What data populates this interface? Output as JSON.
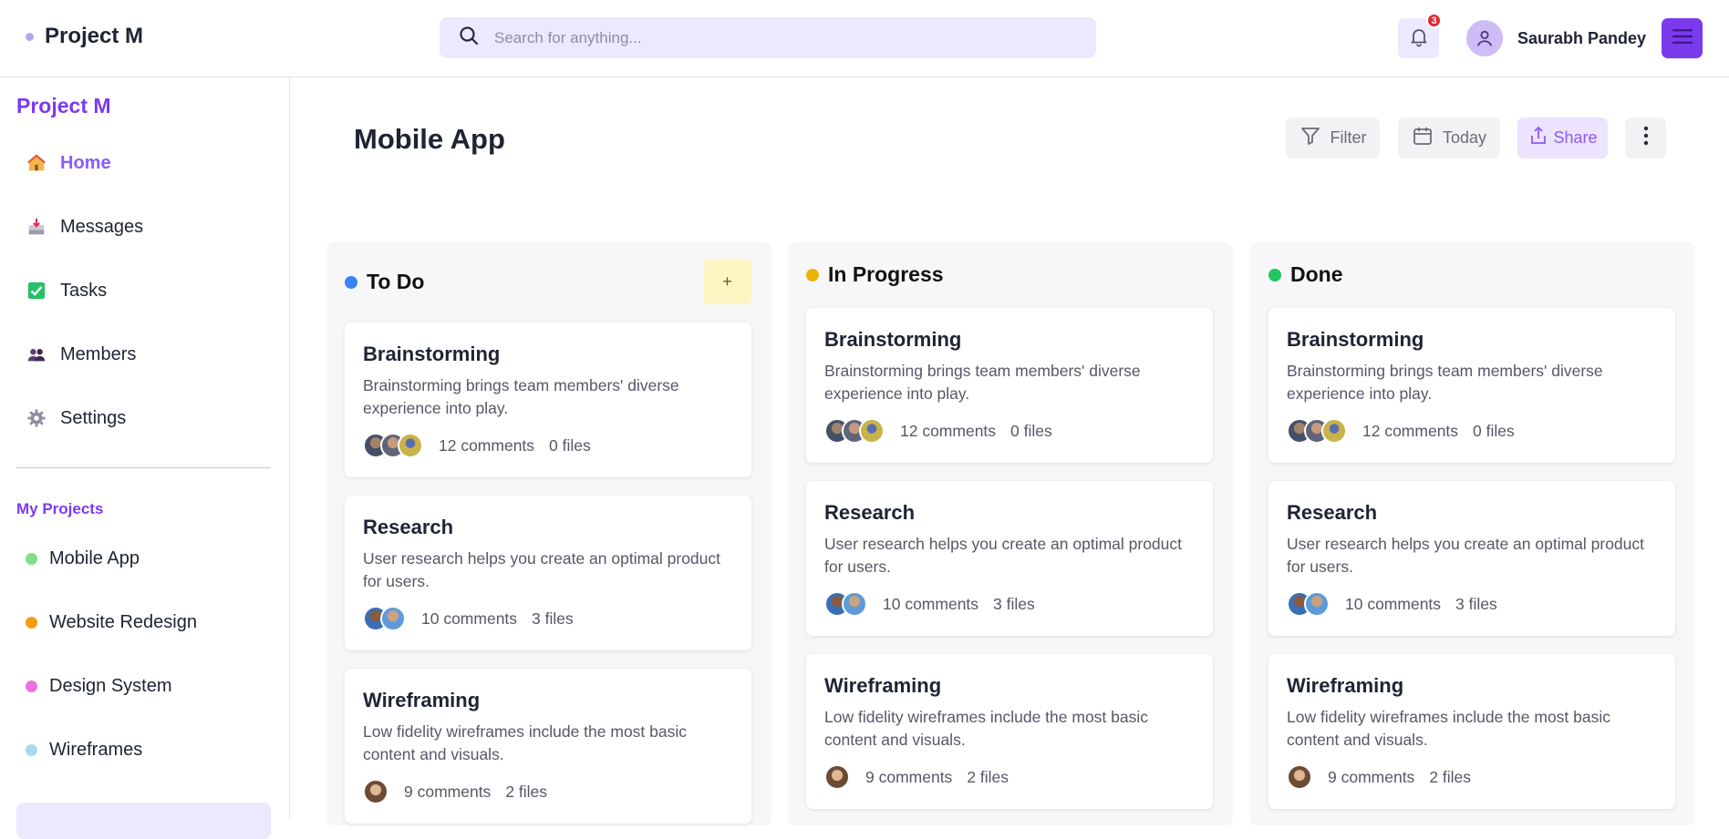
{
  "header": {
    "brand": "Project M",
    "search_placeholder": "Search for anything...",
    "notification_count": "3",
    "user_name": "Saurabh Pandey"
  },
  "sidebar": {
    "title": "Project M",
    "nav": [
      {
        "label": "Home",
        "icon": "house-icon",
        "active": true
      },
      {
        "label": "Messages",
        "icon": "inbox-icon"
      },
      {
        "label": "Tasks",
        "icon": "check-box-icon"
      },
      {
        "label": "Members",
        "icon": "people-icon"
      },
      {
        "label": "Settings",
        "icon": "gear-icon"
      }
    ],
    "projects_heading": "My Projects",
    "projects": [
      {
        "label": "Mobile App",
        "color": "#7fe08a"
      },
      {
        "label": "Website Redesign",
        "color": "#f59e0b"
      },
      {
        "label": "Design System",
        "color": "#ee6fe0"
      },
      {
        "label": "Wireframes",
        "color": "#a9d8e8"
      }
    ]
  },
  "main": {
    "title": "Mobile App",
    "toolbar": {
      "filter": "Filter",
      "today": "Today",
      "share": "Share"
    },
    "add_label": "+",
    "columns": [
      {
        "title": "To Do",
        "color": "#3b82f6",
        "cards": [
          {
            "title": "Brainstorming",
            "desc": "Brainstorming brings team members' diverse experience into play.",
            "comments": "12 comments",
            "files": "0 files"
          },
          {
            "title": "Research",
            "desc": "User research helps you create an optimal product for users.",
            "comments": "10 comments",
            "files": "3 files"
          },
          {
            "title": "Wireframing",
            "desc": "Low fidelity wireframes include the most basic content and visuals.",
            "comments": "9 comments",
            "files": "2 files"
          }
        ]
      },
      {
        "title": "In Progress",
        "color": "#eab308",
        "cards": [
          {
            "title": "Brainstorming",
            "desc": "Brainstorming brings team members' diverse experience into play.",
            "comments": "12 comments",
            "files": "0 files"
          },
          {
            "title": "Research",
            "desc": "User research helps you create an optimal product for users.",
            "comments": "10 comments",
            "files": "3 files"
          },
          {
            "title": "Wireframing",
            "desc": "Low fidelity wireframes include the most basic content and visuals.",
            "comments": "9 comments",
            "files": "2 files"
          }
        ]
      },
      {
        "title": "Done",
        "color": "#22c55e",
        "cards": [
          {
            "title": "Brainstorming",
            "desc": "Brainstorming brings team members' diverse experience into play.",
            "comments": "12 comments",
            "files": "0 files"
          },
          {
            "title": "Research",
            "desc": "User research helps you create an optimal product for users.",
            "comments": "10 comments",
            "files": "3 files"
          },
          {
            "title": "Wireframing",
            "desc": "Low fidelity wireframes include the most basic content and visuals.",
            "comments": "9 comments",
            "files": "2 files"
          }
        ]
      }
    ]
  }
}
